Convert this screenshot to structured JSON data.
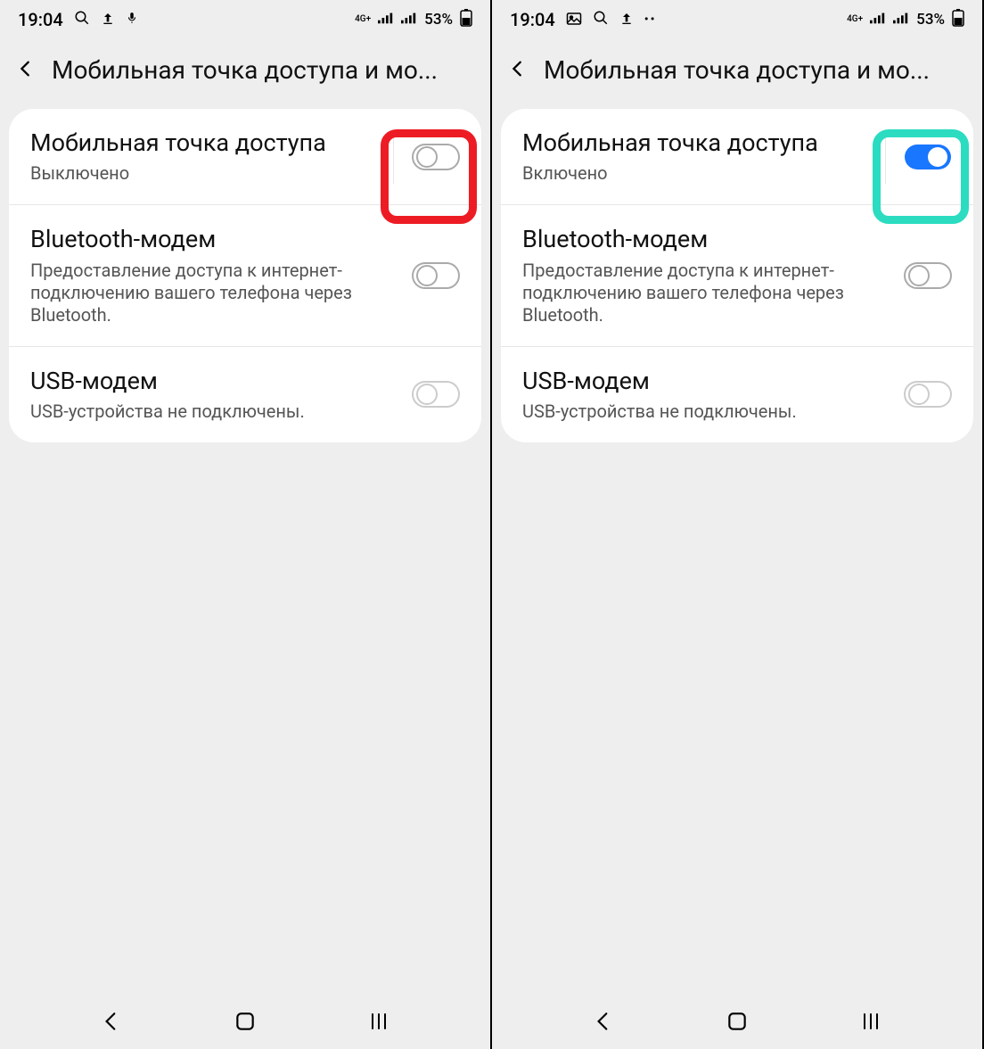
{
  "screens": [
    {
      "status": {
        "time": "19:04",
        "battery": "53%",
        "net": "4G+"
      },
      "title": "Мобильная точка доступа и мо...",
      "rows": [
        {
          "title": "Мобильная точка доступа",
          "sub": "Выключено",
          "on": false
        },
        {
          "title": "Bluetooth-модем",
          "sub": "Предоставление доступа к интернет-подключению вашего телефона через Bluetooth.",
          "on": false
        },
        {
          "title": "USB-модем",
          "sub": "USB-устройства не подключены.",
          "on": false
        }
      ],
      "annot_color": "red"
    },
    {
      "status": {
        "time": "19:04",
        "battery": "53%",
        "net": "4G+"
      },
      "title": "Мобильная точка доступа и мо...",
      "rows": [
        {
          "title": "Мобильная точка доступа",
          "sub": "Включено",
          "on": true
        },
        {
          "title": "Bluetooth-модем",
          "sub": "Предоставление доступа к интернет-подключению вашего телефона через Bluetooth.",
          "on": false
        },
        {
          "title": "USB-модем",
          "sub": "USB-устройства не подключены.",
          "on": false
        }
      ],
      "annot_color": "teal"
    }
  ]
}
